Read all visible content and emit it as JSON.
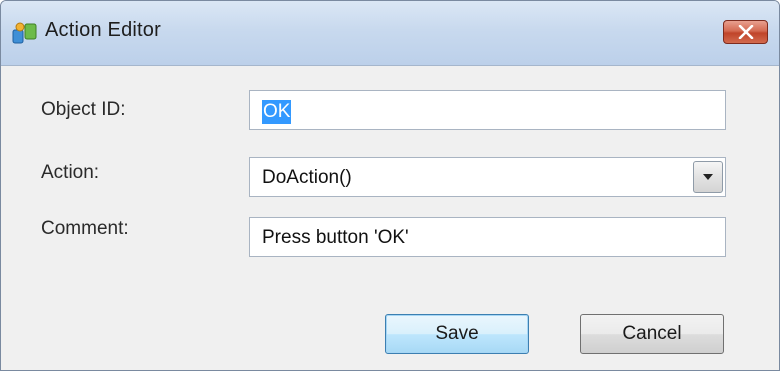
{
  "window": {
    "title": "Action Editor",
    "app_icon": "app-icon",
    "close_icon": "close-icon"
  },
  "form": {
    "object_id_label": "Object ID:",
    "object_id_value": "OK",
    "action_label": "Action:",
    "action_value": "DoAction()",
    "comment_label": "Comment:",
    "comment_value": "Press button 'OK'"
  },
  "buttons": {
    "save_label": "Save",
    "cancel_label": "Cancel"
  },
  "colors": {
    "selection": "#3399ff",
    "close_button": "#c0442a",
    "default_button": "#bee6fd"
  }
}
